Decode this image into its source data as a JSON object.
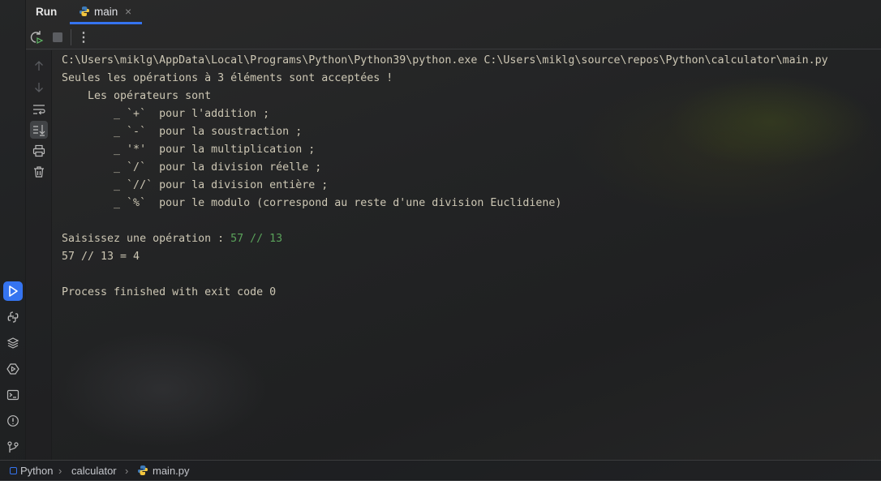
{
  "tabbar": {
    "title": "Run",
    "tab_label": "main"
  },
  "console": {
    "lines": [
      "C:\\Users\\miklg\\AppData\\Local\\Programs\\Python\\Python39\\python.exe C:\\Users\\miklg\\source\\repos\\Python\\calculator\\main.py",
      "Seules les opérations à 3 éléments sont acceptées !",
      "    Les opérateurs sont",
      "        _ `+`  pour l'addition ;",
      "        _ `-`  pour la soustraction ;",
      "        _ '*'  pour la multiplication ;",
      "        _ `/`  pour la division réelle ;",
      "        _ `//` pour la division entière ;",
      "        _ `%`  pour le modulo (correspond au reste d'une division Euclidiene)",
      "",
      "Saisissez une opération : ",
      "57 // 13 = 4",
      "",
      "Process finished with exit code 0"
    ],
    "user_input": "57 // 13"
  },
  "status": {
    "breadcrumb": [
      "Python",
      "calculator",
      "main.py"
    ]
  },
  "colors": {
    "accent": "#3574f0",
    "input": "#5aa25a",
    "text": "#cdc7b4"
  }
}
